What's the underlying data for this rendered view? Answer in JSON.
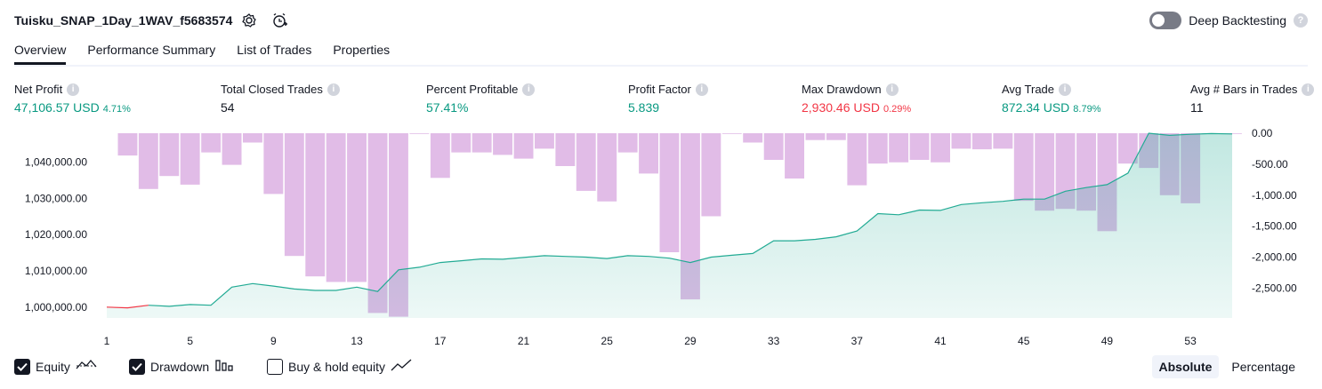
{
  "header": {
    "title": "Tuisku_SNAP_1Day_1WAV_f5683574",
    "settings_icon": "gear-icon",
    "alert_icon": "alarm-plus-icon",
    "deep_backtesting_label": "Deep Backtesting",
    "deep_backtesting_enabled": false
  },
  "tabs": [
    {
      "label": "Overview",
      "active": true
    },
    {
      "label": "Performance Summary",
      "active": false
    },
    {
      "label": "List of Trades",
      "active": false
    },
    {
      "label": "Properties",
      "active": false
    }
  ],
  "metrics": {
    "net_profit": {
      "label": "Net Profit",
      "value": "47,106.57 USD",
      "pct": "4.71%"
    },
    "total_closed_trades": {
      "label": "Total Closed Trades",
      "value": "54"
    },
    "percent_profitable": {
      "label": "Percent Profitable",
      "value": "57.41%"
    },
    "profit_factor": {
      "label": "Profit Factor",
      "value": "5.839"
    },
    "max_drawdown": {
      "label": "Max Drawdown",
      "value": "2,930.46 USD",
      "pct": "0.29%"
    },
    "avg_trade": {
      "label": "Avg Trade",
      "value": "872.34 USD",
      "pct": "8.79%"
    },
    "avg_bars": {
      "label": "Avg # Bars in Trades",
      "value": "11"
    }
  },
  "chart_data": {
    "type": "area",
    "left_axis": {
      "ticks": [
        1000000,
        1010000,
        1020000,
        1030000,
        1040000
      ],
      "tick_labels": [
        "1,000,000.00",
        "1,010,000.00",
        "1,020,000.00",
        "1,030,000.00",
        "1,040,000.00"
      ],
      "ylim": [
        997000,
        1048000
      ]
    },
    "right_axis": {
      "ticks": [
        0,
        -500,
        -1000,
        -1500,
        -2000,
        -2500
      ],
      "tick_labels": [
        "0.00",
        "-500.00",
        "-1,000.00",
        "-1,500.00",
        "-2,000.00",
        "-2,500.00"
      ],
      "ylim": [
        -2980,
        0
      ]
    },
    "x_ticks": [
      1,
      5,
      9,
      13,
      17,
      21,
      25,
      29,
      33,
      37,
      41,
      45,
      49,
      53
    ],
    "x_range": [
      1,
      55
    ],
    "series": [
      {
        "name": "Equity",
        "color": "#22ab94",
        "x": [
          1,
          2,
          3,
          4,
          5,
          6,
          7,
          8,
          9,
          10,
          11,
          12,
          13,
          14,
          15,
          16,
          17,
          18,
          19,
          20,
          21,
          22,
          23,
          24,
          25,
          26,
          27,
          28,
          29,
          30,
          31,
          32,
          33,
          34,
          35,
          36,
          37,
          38,
          39,
          40,
          41,
          42,
          43,
          44,
          45,
          46,
          47,
          48,
          49,
          50,
          51,
          52,
          53,
          54,
          55
        ],
        "values": [
          1000000,
          999800,
          1000500,
          1000200,
          1000700,
          1000500,
          1005500,
          1006500,
          1005800,
          1005000,
          1004600,
          1004600,
          1005500,
          1004300,
          1010300,
          1011000,
          1012300,
          1012800,
          1013300,
          1013200,
          1013700,
          1014200,
          1014000,
          1013800,
          1013400,
          1014200,
          1014000,
          1013500,
          1012300,
          1013800,
          1014300,
          1014800,
          1018300,
          1018300,
          1018700,
          1019400,
          1021000,
          1025800,
          1025500,
          1026800,
          1026700,
          1028300,
          1028800,
          1029200,
          1029800,
          1029800,
          1032000,
          1033000,
          1033800,
          1037000,
          1048000,
          1047400,
          1047700,
          1047900,
          1047800
        ],
        "negative_color": "#f23645",
        "negative_until_x": 3
      },
      {
        "name": "Drawdown",
        "color": "#ce93d8",
        "x": [
          2,
          3,
          4,
          5,
          6,
          7,
          8,
          9,
          10,
          11,
          12,
          13,
          14,
          15,
          16,
          17,
          18,
          19,
          20,
          21,
          22,
          23,
          24,
          25,
          26,
          27,
          28,
          29,
          30,
          31,
          32,
          33,
          34,
          35,
          36,
          37,
          38,
          39,
          40,
          41,
          42,
          43,
          44,
          45,
          46,
          47,
          48,
          49,
          50,
          51,
          52,
          53,
          54,
          55
        ],
        "values": [
          -360,
          -900,
          -690,
          -830,
          -310,
          -510,
          -150,
          -980,
          -1980,
          -2310,
          -2400,
          -2400,
          -2900,
          -2960,
          0,
          -720,
          -310,
          -310,
          -350,
          -410,
          -250,
          -530,
          -930,
          -1100,
          -310,
          -650,
          -1920,
          -2680,
          -1340,
          0,
          -150,
          -430,
          -730,
          -110,
          -110,
          -840,
          -490,
          -470,
          -430,
          -470,
          -250,
          -260,
          -250,
          -1090,
          -1250,
          -1220,
          -1250,
          -1580,
          -490,
          -560,
          -1000,
          -1130,
          0,
          0
        ]
      }
    ]
  },
  "legend": {
    "items": [
      {
        "label": "Equity",
        "checked": true,
        "icon": "equity-line-icon"
      },
      {
        "label": "Drawdown",
        "checked": true,
        "icon": "drawdown-bars-icon"
      },
      {
        "label": "Buy & hold equity",
        "checked": false,
        "icon": "buy-hold-line-icon"
      }
    ],
    "mode_options": [
      "Absolute",
      "Percentage"
    ],
    "mode_selected": "Absolute"
  }
}
